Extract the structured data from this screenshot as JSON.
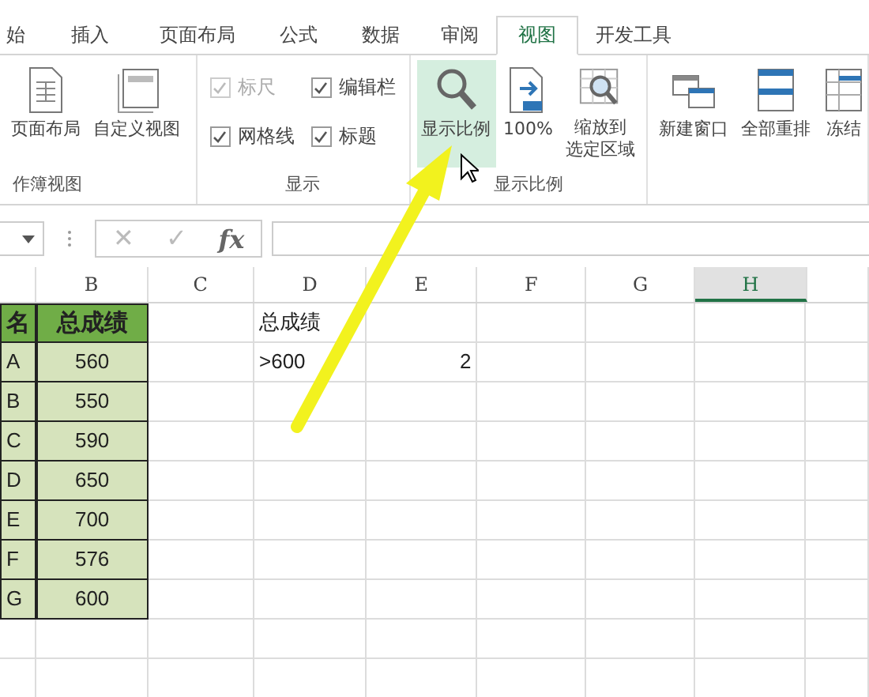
{
  "tabs": [
    {
      "label": "始",
      "selected": false
    },
    {
      "label": "插入",
      "selected": false
    },
    {
      "label": "页面布局",
      "selected": false
    },
    {
      "label": "公式",
      "selected": false
    },
    {
      "label": "数据",
      "selected": false
    },
    {
      "label": "审阅",
      "selected": false
    },
    {
      "label": "视图",
      "selected": true
    },
    {
      "label": "开发工具",
      "selected": false
    }
  ],
  "ribbon": {
    "groups": [
      {
        "label": "作簿视图",
        "items": [
          {
            "kind": "button",
            "label": "页面布局",
            "highlighted": false
          },
          {
            "kind": "button",
            "label": "自定义视图",
            "highlighted": false
          }
        ]
      },
      {
        "label": "显示",
        "items": [
          {
            "kind": "checkbox",
            "label": "标尺",
            "checked": true,
            "disabled": true
          },
          {
            "kind": "checkbox",
            "label": "编辑栏",
            "checked": true,
            "disabled": false
          },
          {
            "kind": "checkbox",
            "label": "网格线",
            "checked": true,
            "disabled": false
          },
          {
            "kind": "checkbox",
            "label": "标题",
            "checked": true,
            "disabled": false
          }
        ]
      },
      {
        "label": "显示比例",
        "items": [
          {
            "kind": "button",
            "label": "显示比例",
            "highlighted": true
          },
          {
            "kind": "button",
            "label": "100%",
            "highlighted": false
          },
          {
            "kind": "button",
            "label_lines": [
              "缩放到",
              "选定区域"
            ],
            "highlighted": false
          }
        ]
      },
      {
        "items": [
          {
            "kind": "button",
            "label": "新建窗口",
            "highlighted": false
          },
          {
            "kind": "button",
            "label": "全部重排",
            "highlighted": false
          },
          {
            "kind": "button",
            "label": "冻结",
            "highlighted": false
          }
        ]
      }
    ]
  },
  "formula_bar": {
    "cancel": "✕",
    "enter": "✓",
    "function": "fx"
  },
  "sheet": {
    "columns": [
      {
        "selected": false
      },
      {
        "label": "B",
        "selected": false
      },
      {
        "label": "C",
        "selected": false
      },
      {
        "label": "D",
        "selected": false
      },
      {
        "label": "E",
        "selected": false
      },
      {
        "label": "F",
        "selected": false
      },
      {
        "label": "G",
        "selected": false
      },
      {
        "label": "H",
        "selected": true
      },
      {
        "selected": false
      }
    ],
    "rows": [
      {
        "kind": "header",
        "cells": [
          "名",
          "总成绩",
          null,
          "总成绩"
        ]
      },
      {
        "kind": "data",
        "cells": [
          "A",
          "560",
          null,
          ">600",
          "2"
        ]
      },
      {
        "kind": "data",
        "cells": [
          "B",
          "550"
        ]
      },
      {
        "kind": "data",
        "cells": [
          "C",
          "590"
        ]
      },
      {
        "kind": "data",
        "cells": [
          "D",
          "650"
        ]
      },
      {
        "kind": "data",
        "cells": [
          "E",
          "700"
        ]
      },
      {
        "kind": "data",
        "cells": [
          "F",
          "576"
        ]
      },
      {
        "kind": "data",
        "cells": [
          "G",
          "600"
        ]
      },
      {
        "kind": "empty"
      },
      {
        "kind": "empty"
      }
    ]
  }
}
